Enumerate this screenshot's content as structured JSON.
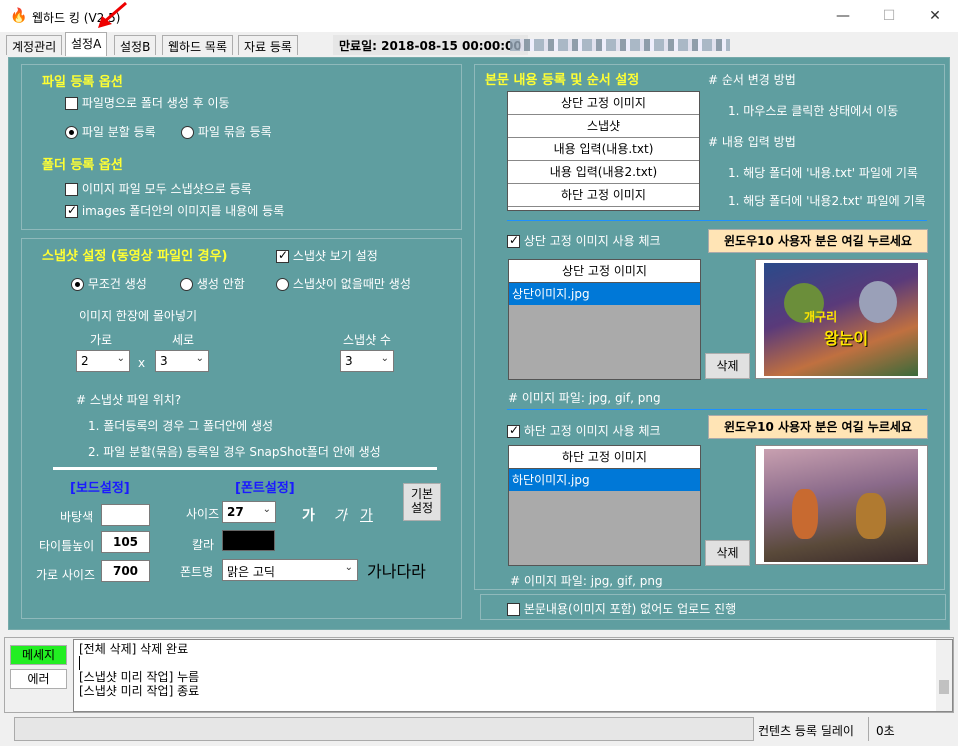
{
  "window": {
    "title": "웹하드 킹 (V2.5)",
    "minimize": "—",
    "maximize": "☐",
    "close": "✕"
  },
  "tabs": [
    "계정관리",
    "설정A",
    "설정B",
    "웹하드 목록",
    "자료 등록"
  ],
  "expiry": "만료일: 2018-08-15 00:00:00",
  "file_options": {
    "heading": "파일 등록 옵션",
    "make_folder": "파일명으로 폴더 생성 후 이동",
    "split": "파일 분할 등록",
    "bundle": "파일 묶음 등록"
  },
  "folder_options": {
    "heading": "폴더 등록 옵션",
    "all_snapshot": "이미지 파일 모두 스냅샷으로 등록",
    "images_content": "images 폴더안의 이미지를 내용에 등록"
  },
  "snapshot": {
    "heading": "스냅샷 설정 (동영상 파일인 경우)",
    "show_setting": "스냅샷 보기 설정",
    "always": "무조건 생성",
    "never": "생성 안함",
    "only_missing": "스냅샷이 없을때만 생성",
    "merge_label": "이미지 한장에 몰아넣기",
    "width_label": "가로",
    "height_label": "세로",
    "count_label": "스냅샷 수",
    "width_value": "2",
    "times": "x",
    "height_value": "3",
    "count_value": "3",
    "location_q": "# 스냅샷 파일 위치?",
    "loc1": "1. 폴더등록의 경우 그 폴더안에 생성",
    "loc2": "2. 파일 분할(묶음) 등록일 경우 SnapShot폴더 안에 생성"
  },
  "board": {
    "heading": "[보드설정]",
    "bg_label": "바탕색",
    "title_height_label": "타이틀높이",
    "title_height": "105",
    "width_label": "가로 사이즈",
    "width": "700"
  },
  "font": {
    "heading": "[폰트설정]",
    "size_label": "사이즈",
    "size": "27",
    "color_label": "칼라",
    "name_label": "폰트명",
    "name": "맑은 고딕",
    "sample1": "가",
    "sample2": "가",
    "sample3": "가",
    "preview": "가나다라",
    "default_btn": "기본\n설정",
    "color_value": "#000000"
  },
  "content": {
    "heading": "본문 내용 등록 및 순서 설정",
    "order_items": [
      "상단 고정 이미지",
      "스냅샷",
      "내용 입력(내용.txt)",
      "내용 입력(내용2.txt)",
      "하단 고정 이미지"
    ],
    "howto_order": "# 순서 변경 방법",
    "howto_order_1": "1. 마우스로 클릭한 상태에서 이동",
    "howto_input": "# 내용 입력 방법",
    "howto_input_1": "1. 해당 폴더에 '내용.txt' 파일에 기록",
    "howto_input_2": "1. 해당 폴더에 '내용2.txt' 파일에 기록"
  },
  "top_image": {
    "check_label": "상단 고정 이미지 사용 체크",
    "notice": "윈도우10 사용자 분은 여길 누르세요",
    "list_header": "상단 고정 이미지",
    "file": "상단이미지.jpg",
    "delete": "삭제",
    "types": "# 이미지 파일: jpg, gif, png",
    "thumb_text1": "개구리",
    "thumb_text2": "왕눈이"
  },
  "bottom_image": {
    "check_label": "하단 고정 이미지 사용 체크",
    "notice": "윈도우10 사용자 분은 여길 누르세요",
    "list_header": "하단 고정 이미지",
    "file": "하단이미지.jpg",
    "delete": "삭제",
    "types": "# 이미지 파일: jpg, gif, png"
  },
  "upload_even_empty": "본문내용(이미지 포함) 없어도 업로드 진행",
  "log": {
    "message_btn": "메세지",
    "error_btn": "에러",
    "lines": [
      "[전체 삭제] 삭제 완료",
      "",
      "[스냅샷 미리 작업] 누름",
      "[스냅샷 미리 작업] 종료"
    ]
  },
  "status": {
    "delay_label": "컨텐츠 등록 딜레이",
    "delay_value": "0초"
  }
}
